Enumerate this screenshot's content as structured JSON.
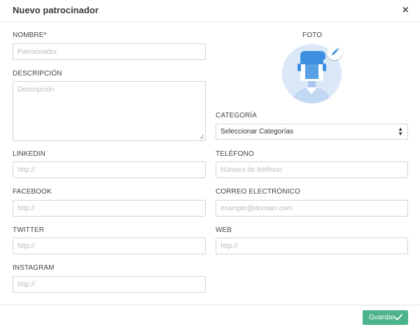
{
  "modal": {
    "title": "Nuevo patrocinador",
    "close_glyph": "×"
  },
  "fields": {
    "nombre": {
      "label": "NOMBRE*",
      "placeholder": "Patrocinador",
      "value": ""
    },
    "descripcion": {
      "label": "DESCRIPCIÓN",
      "placeholder": "Descripción",
      "value": ""
    },
    "linkedin": {
      "label": "LINKEDIN",
      "placeholder": "http://",
      "value": ""
    },
    "facebook": {
      "label": "FACEBOOK",
      "placeholder": "http://",
      "value": ""
    },
    "twitter": {
      "label": "TWITTER",
      "placeholder": "http://",
      "value": ""
    },
    "instagram": {
      "label": "INSTAGRAM",
      "placeholder": "http://",
      "value": ""
    },
    "categoria": {
      "label": "CATEGORÍA",
      "selected": "Seleccionar Categorías"
    },
    "telefono": {
      "label": "TELÉFONO",
      "placeholder": "Número de teléfono",
      "value": ""
    },
    "correo": {
      "label": "CORREO ELECTRÓNICO",
      "placeholder": "example@domain.com",
      "value": ""
    },
    "web": {
      "label": "WEB",
      "placeholder": "http://",
      "value": ""
    }
  },
  "photo": {
    "label": "FOTO",
    "avatar_icon": "person-avatar-icon",
    "edit_icon": "pencil-icon"
  },
  "footer": {
    "save_label": "Guardar",
    "save_icon": "check-icon"
  },
  "colors": {
    "accent_green": "#4cb38a",
    "edit_blue": "#3d8fe0",
    "avatar_bg": "#dbe8f8",
    "border": "#cfd5db"
  }
}
